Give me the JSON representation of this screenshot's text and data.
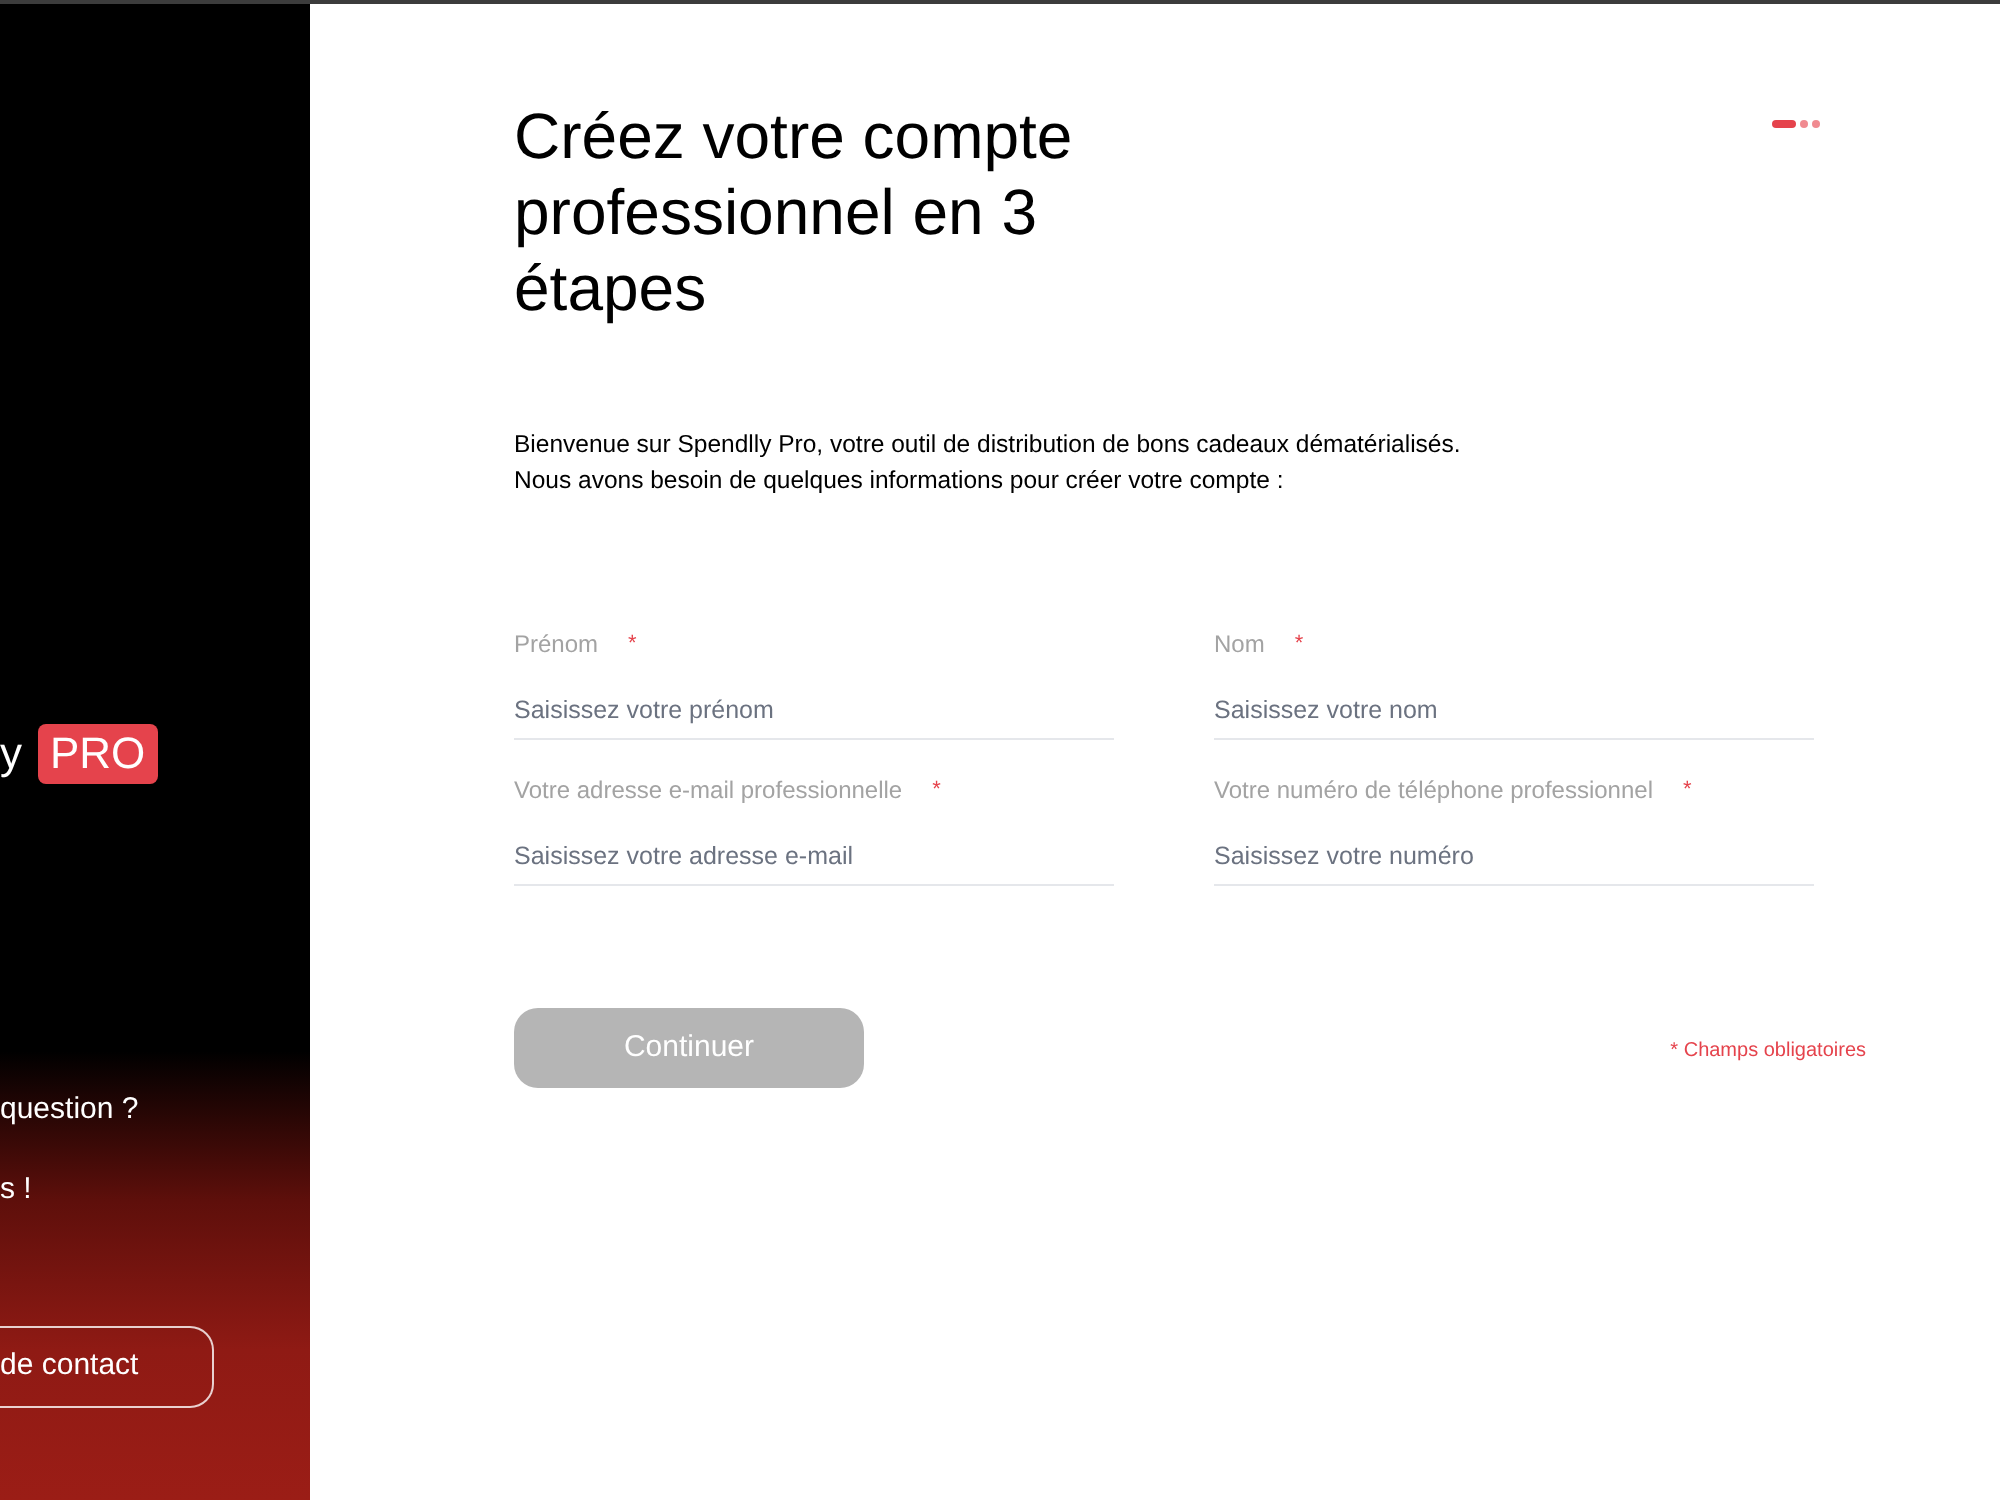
{
  "sidebar": {
    "logo": {
      "text": "y",
      "badge": "PRO"
    },
    "help_lines": [
      "question ?",
      "s !"
    ],
    "contact_button": "de contact"
  },
  "steps": [
    {
      "selected": true
    },
    {
      "selected": false
    },
    {
      "selected": false
    }
  ],
  "title": "Créez votre compte professionnel en 3 étapes",
  "intro": [
    "Bienvenue sur Spendlly Pro, votre outil de distribution de bons cadeaux dématérialisés.",
    "Nous avons besoin de quelques informations pour créer votre compte :"
  ],
  "fields": [
    {
      "label": "Prénom",
      "mark": "*",
      "placeholder": "Saisissez votre prénom"
    },
    {
      "label": "Nom",
      "mark": "*",
      "placeholder": "Saisissez votre nom"
    },
    {
      "label": "Votre adresse e-mail professionnelle",
      "mark": "*",
      "placeholder": "Saisissez votre adresse e-mail"
    },
    {
      "label": "Votre numéro de téléphone professionnel",
      "mark": "*",
      "placeholder": "Saisissez votre numéro"
    }
  ],
  "submit": {
    "label": "Continuer",
    "disabled": true
  },
  "required_note": "* Champs obligatoires"
}
